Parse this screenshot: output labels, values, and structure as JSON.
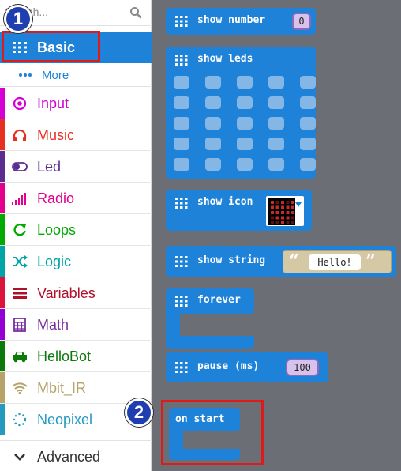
{
  "search": {
    "placeholder": "Search..."
  },
  "categories": [
    {
      "id": "basic",
      "label": "Basic",
      "color": "#1e82d9",
      "icon": "grid-icon",
      "selected": true
    },
    {
      "id": "more",
      "label": "More",
      "color": "#1e82d9",
      "icon": "more-dots-icon"
    },
    {
      "id": "input",
      "label": "Input",
      "color": "#d400d4",
      "icon": "target-icon"
    },
    {
      "id": "music",
      "label": "Music",
      "color": "#e63022",
      "icon": "headphones-icon"
    },
    {
      "id": "led",
      "label": "Led",
      "color": "#5c2d91",
      "icon": "toggle-icon"
    },
    {
      "id": "radio",
      "label": "Radio",
      "color": "#e3008c",
      "icon": "signal-bars-icon"
    },
    {
      "id": "loops",
      "label": "Loops",
      "color": "#00aa00",
      "icon": "refresh-icon"
    },
    {
      "id": "logic",
      "label": "Logic",
      "color": "#00a4a6",
      "icon": "shuffle-icon"
    },
    {
      "id": "variables",
      "label": "Variables",
      "color": "#dc143c",
      "icon": "lines-icon"
    },
    {
      "id": "math",
      "label": "Math",
      "color": "#9400d3",
      "icon": "calculator-icon"
    },
    {
      "id": "hellobot",
      "label": "HelloBot",
      "color": "#0b7a0b",
      "icon": "car-icon"
    },
    {
      "id": "mbit_ir",
      "label": "Mbit_IR",
      "color": "#b5a36a",
      "icon": "wifi-icon"
    },
    {
      "id": "neopixel",
      "label": "Neopixel",
      "color": "#2699bf",
      "icon": "dotted-circle-icon"
    }
  ],
  "advanced": {
    "label": "Advanced",
    "icon": "chevron-down-icon"
  },
  "blocks": {
    "show_number": {
      "label": "show number",
      "value": "0"
    },
    "show_leds": {
      "label": "show leds"
    },
    "show_icon": {
      "label": "show icon",
      "icon": "dropdown-arrow-icon"
    },
    "show_string": {
      "label": "show string",
      "value": "Hello!",
      "open_quote": "“",
      "close_quote": "”"
    },
    "forever": {
      "label": "forever"
    },
    "pause": {
      "label": "pause (ms)",
      "value": "100"
    },
    "on_start": {
      "label": "on start"
    }
  },
  "annotations": {
    "badge1": "1",
    "badge2": "2",
    "highlight_color": "#e01919"
  }
}
